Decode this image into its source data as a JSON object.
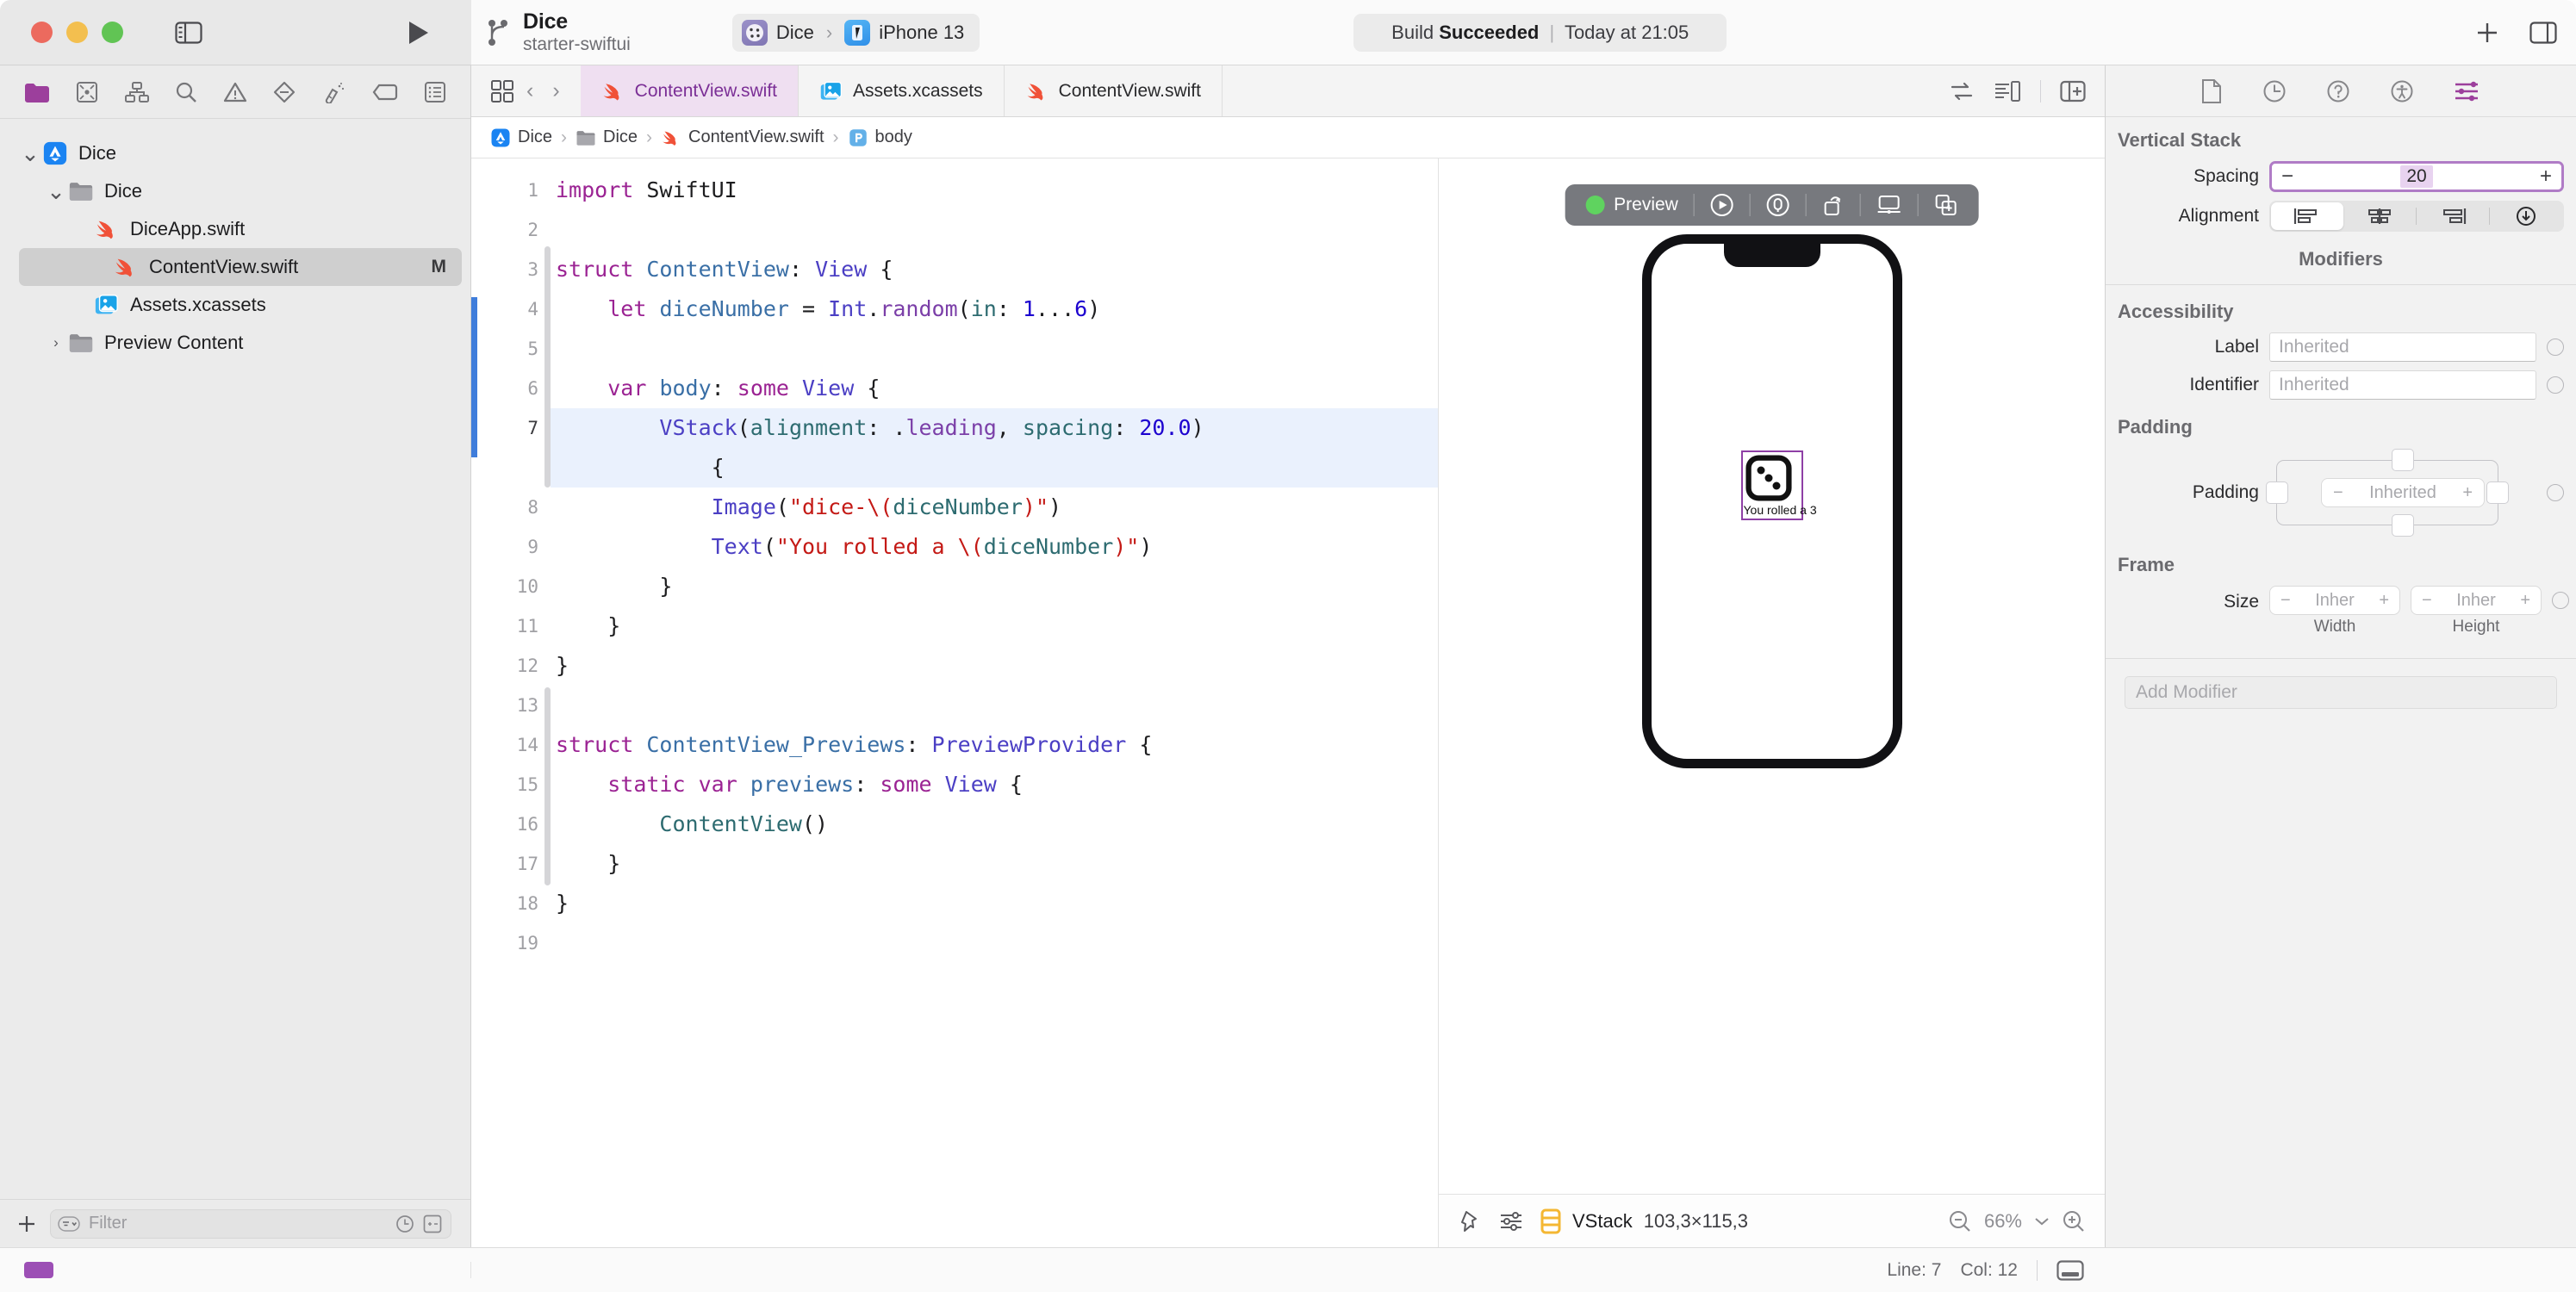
{
  "window": {
    "traffic_lights": [
      "close",
      "minimize",
      "zoom"
    ],
    "colors": {
      "close": "#ec6a5e",
      "minimize": "#f3bf4f",
      "zoom": "#61c454",
      "accent_purple": "#9c4fb5",
      "selection_blue": "#eaf1fd",
      "edit_marker_blue": "#3f7ddb"
    }
  },
  "toolbar": {
    "project_title": "Dice",
    "branch_name": "starter-swiftui",
    "scheme": {
      "target": "Dice",
      "separator": "›",
      "destination": "iPhone 13"
    },
    "status": {
      "prefix": "Build",
      "result": "Succeeded",
      "separator": "|",
      "time": "Today at 21:05"
    },
    "run_button": "run-icon",
    "sidebar_toggle": "sidebar-toggle-icon",
    "inspector_toggle": "inspector-toggle-icon",
    "add_button": "+"
  },
  "navigator": {
    "tabs": [
      {
        "name": "project-navigator",
        "icon": "folder-icon",
        "active": true
      },
      {
        "name": "source-control-navigator",
        "icon": "source-control-icon",
        "active": false
      },
      {
        "name": "symbol-navigator",
        "icon": "hierarchy-icon",
        "active": false
      },
      {
        "name": "find-navigator",
        "icon": "search-icon",
        "active": false
      },
      {
        "name": "issue-navigator",
        "icon": "warning-icon",
        "active": false
      },
      {
        "name": "test-navigator",
        "icon": "diamond-icon",
        "active": false
      },
      {
        "name": "debug-navigator",
        "icon": "spray-icon",
        "active": false
      },
      {
        "name": "breakpoint-navigator",
        "icon": "tag-icon",
        "active": false
      },
      {
        "name": "report-navigator",
        "icon": "report-icon",
        "active": false
      }
    ],
    "tree": [
      {
        "label": "Dice",
        "icon": "xcode-project-icon",
        "indent": 0,
        "twisty": "down",
        "selected": false,
        "badge": ""
      },
      {
        "label": "Dice",
        "icon": "folder-icon",
        "indent": 1,
        "twisty": "down",
        "selected": false,
        "badge": ""
      },
      {
        "label": "DiceApp.swift",
        "icon": "swift-icon",
        "indent": 2,
        "twisty": "",
        "selected": false,
        "badge": ""
      },
      {
        "label": "ContentView.swift",
        "icon": "swift-icon",
        "indent": 2,
        "twisty": "",
        "selected": true,
        "badge": "M"
      },
      {
        "label": "Assets.xcassets",
        "icon": "assets-icon",
        "indent": 2,
        "twisty": "",
        "selected": false,
        "badge": ""
      },
      {
        "label": "Preview Content",
        "icon": "folder-icon",
        "indent": 1,
        "twisty": "right",
        "selected": false,
        "badge": ""
      }
    ],
    "filter": {
      "placeholder": "Filter",
      "add_label": "+",
      "recent_icon": "clock-icon",
      "source-control_icon": "sc-filter-icon"
    }
  },
  "editor": {
    "tabs": [
      {
        "label": "ContentView.swift",
        "icon": "swift-icon",
        "active": true
      },
      {
        "label": "Assets.xcassets",
        "icon": "assets-icon",
        "active": false
      },
      {
        "label": "ContentView.swift",
        "icon": "swift-icon",
        "active": false
      }
    ],
    "nav_back": "‹",
    "nav_forward": "›",
    "tab_grid_icon": "tab-grid-icon",
    "right_icons": [
      "related-items-icon",
      "minimap-icon",
      "add-editor-icon"
    ],
    "breadcrumb": [
      {
        "label": "Dice",
        "icon": "xcode-project-icon"
      },
      {
        "label": "Dice",
        "icon": "folder-icon"
      },
      {
        "label": "ContentView.swift",
        "icon": "swift-icon"
      },
      {
        "label": "body",
        "icon": "property-icon"
      }
    ],
    "line_numbers": [
      "1",
      "2",
      "3",
      "4",
      "5",
      "6",
      "7",
      "8",
      "9",
      "10",
      "11",
      "12",
      "13",
      "14",
      "15",
      "16",
      "17",
      "18",
      "19"
    ]
  },
  "canvas": {
    "preview_toolbar": {
      "status_label": "Preview",
      "status_color": "#5fd35f",
      "icons": [
        "live-preview-icon",
        "inspect-preview-icon",
        "run-device-icon",
        "display-icon",
        "duplicate-preview-icon"
      ]
    },
    "device": "iPhone 13",
    "preview_text": "You rolled a 3",
    "dice_value": 3,
    "selection_color": "#8e3fa5",
    "bottom_bar": {
      "pin_icon": "pin-icon",
      "variants_icon": "variants-icon",
      "selected_view_icon": "vstack-icon",
      "selected_view": "VStack",
      "dimensions": "103,3×115,3",
      "zoom_out_icon": "zoom-out-icon",
      "zoom_level": "66%",
      "zoom_menu_icon": "chevron-down-icon",
      "zoom_in_icon": "zoom-in-icon"
    }
  },
  "inspector": {
    "tabs": [
      {
        "name": "file-inspector",
        "icon": "file-icon",
        "active": false
      },
      {
        "name": "history-inspector",
        "icon": "clock-icon",
        "active": false
      },
      {
        "name": "quick-help-inspector",
        "icon": "question-icon",
        "active": false
      },
      {
        "name": "accessibility-inspector",
        "icon": "accessibility-icon",
        "active": false
      },
      {
        "name": "attributes-inspector",
        "icon": "sliders-icon",
        "active": true
      }
    ],
    "section_title": "Vertical Stack",
    "spacing": {
      "label": "Spacing",
      "value": "20",
      "minus": "−",
      "plus": "+",
      "focused": true
    },
    "alignment": {
      "label": "Alignment",
      "options": [
        "align-leading-icon",
        "align-center-icon",
        "align-trailing-icon",
        "align-baseline-icon"
      ],
      "selected_index": 0
    },
    "modifiers_header": "Modifiers",
    "accessibility": {
      "title": "Accessibility",
      "fields": [
        {
          "label": "Label",
          "placeholder": "Inherited",
          "value": ""
        },
        {
          "label": "Identifier",
          "placeholder": "Inherited",
          "value": ""
        }
      ]
    },
    "padding": {
      "title": "Padding",
      "label": "Padding",
      "placeholder": "Inherited",
      "minus": "−",
      "plus": "+",
      "edges": [
        "top",
        "leading",
        "trailing",
        "bottom"
      ]
    },
    "frame": {
      "title": "Frame",
      "label": "Size",
      "width": {
        "placeholder": "Inher",
        "sublabel": "Width",
        "minus": "−",
        "plus": "+"
      },
      "height": {
        "placeholder": "Inher",
        "sublabel": "Height",
        "minus": "−",
        "plus": "+"
      }
    },
    "add_modifier_placeholder": "Add Modifier"
  },
  "status_bar": {
    "line_label": "Line: 7",
    "col_label": "Col: 12",
    "debug_area_icon": "debug-area-icon"
  },
  "code": {
    "lines": [
      {
        "n": "1",
        "tokens": [
          {
            "t": "import",
            "c": "kw"
          },
          {
            "t": " ",
            "c": "id"
          },
          {
            "t": "SwiftUI",
            "c": "id"
          }
        ]
      },
      {
        "n": "2",
        "tokens": []
      },
      {
        "n": "3",
        "tokens": [
          {
            "t": "struct",
            "c": "kw"
          },
          {
            "t": " ",
            "c": "id"
          },
          {
            "t": "ContentView",
            "c": "type"
          },
          {
            "t": ": ",
            "c": "id"
          },
          {
            "t": "View",
            "c": "typeb"
          },
          {
            "t": " {",
            "c": "id"
          }
        ]
      },
      {
        "n": "4",
        "tokens": [
          {
            "t": "    ",
            "c": "id"
          },
          {
            "t": "let",
            "c": "kw"
          },
          {
            "t": " ",
            "c": "id"
          },
          {
            "t": "diceNumber",
            "c": "type"
          },
          {
            "t": " = ",
            "c": "id"
          },
          {
            "t": "Int",
            "c": "typeb"
          },
          {
            "t": ".",
            "c": "id"
          },
          {
            "t": "random",
            "c": "prop"
          },
          {
            "t": "(",
            "c": "id"
          },
          {
            "t": "in",
            "c": "fn"
          },
          {
            "t": ": ",
            "c": "id"
          },
          {
            "t": "1",
            "c": "num"
          },
          {
            "t": "...",
            "c": "id"
          },
          {
            "t": "6",
            "c": "num"
          },
          {
            "t": ")",
            "c": "id"
          }
        ]
      },
      {
        "n": "5",
        "tokens": []
      },
      {
        "n": "6",
        "tokens": [
          {
            "t": "    ",
            "c": "id"
          },
          {
            "t": "var",
            "c": "kw"
          },
          {
            "t": " ",
            "c": "id"
          },
          {
            "t": "body",
            "c": "type"
          },
          {
            "t": ": ",
            "c": "id"
          },
          {
            "t": "some",
            "c": "kw"
          },
          {
            "t": " ",
            "c": "id"
          },
          {
            "t": "View",
            "c": "typeb"
          },
          {
            "t": " {",
            "c": "id"
          }
        ]
      },
      {
        "n": "7",
        "tokens": [
          {
            "t": "        ",
            "c": "id"
          },
          {
            "t": "VStack",
            "c": "typeb"
          },
          {
            "t": "(",
            "c": "id"
          },
          {
            "t": "alignment",
            "c": "fn"
          },
          {
            "t": ": ",
            "c": "id"
          },
          {
            "t": ".",
            "c": "id"
          },
          {
            "t": "leading",
            "c": "prop"
          },
          {
            "t": ", ",
            "c": "id"
          },
          {
            "t": "spacing",
            "c": "fn"
          },
          {
            "t": ": ",
            "c": "id"
          },
          {
            "t": "20.0",
            "c": "num"
          },
          {
            "t": ")",
            "c": "id"
          }
        ],
        "highlight": true
      },
      {
        "n": "",
        "tokens": [
          {
            "t": "            {",
            "c": "id"
          }
        ],
        "highlight": true,
        "wrap": true
      },
      {
        "n": "8",
        "tokens": [
          {
            "t": "            ",
            "c": "id"
          },
          {
            "t": "Image",
            "c": "typeb"
          },
          {
            "t": "(",
            "c": "id"
          },
          {
            "t": "\"dice-\\(",
            "c": "str"
          },
          {
            "t": "diceNumber",
            "c": "teal"
          },
          {
            "t": ")\"",
            "c": "str"
          },
          {
            "t": ")",
            "c": "id"
          }
        ]
      },
      {
        "n": "9",
        "tokens": [
          {
            "t": "            ",
            "c": "id"
          },
          {
            "t": "Text",
            "c": "typeb"
          },
          {
            "t": "(",
            "c": "id"
          },
          {
            "t": "\"You rolled a \\(",
            "c": "str"
          },
          {
            "t": "diceNumber",
            "c": "teal"
          },
          {
            "t": ")\"",
            "c": "str"
          },
          {
            "t": ")",
            "c": "id"
          }
        ]
      },
      {
        "n": "10",
        "tokens": [
          {
            "t": "        }",
            "c": "id"
          }
        ]
      },
      {
        "n": "11",
        "tokens": [
          {
            "t": "    }",
            "c": "id"
          }
        ]
      },
      {
        "n": "12",
        "tokens": [
          {
            "t": "}",
            "c": "id"
          }
        ]
      },
      {
        "n": "13",
        "tokens": []
      },
      {
        "n": "14",
        "tokens": [
          {
            "t": "struct",
            "c": "kw"
          },
          {
            "t": " ",
            "c": "id"
          },
          {
            "t": "ContentView_Previews",
            "c": "type"
          },
          {
            "t": ": ",
            "c": "id"
          },
          {
            "t": "PreviewProvider",
            "c": "typeb"
          },
          {
            "t": " {",
            "c": "id"
          }
        ]
      },
      {
        "n": "15",
        "tokens": [
          {
            "t": "    ",
            "c": "id"
          },
          {
            "t": "static",
            "c": "kw"
          },
          {
            "t": " ",
            "c": "id"
          },
          {
            "t": "var",
            "c": "kw"
          },
          {
            "t": " ",
            "c": "id"
          },
          {
            "t": "previews",
            "c": "type"
          },
          {
            "t": ": ",
            "c": "id"
          },
          {
            "t": "some",
            "c": "kw"
          },
          {
            "t": " ",
            "c": "id"
          },
          {
            "t": "View",
            "c": "typeb"
          },
          {
            "t": " {",
            "c": "id"
          }
        ]
      },
      {
        "n": "16",
        "tokens": [
          {
            "t": "        ",
            "c": "id"
          },
          {
            "t": "ContentView",
            "c": "fn"
          },
          {
            "t": "()",
            "c": "id"
          }
        ]
      },
      {
        "n": "17",
        "tokens": [
          {
            "t": "    }",
            "c": "id"
          }
        ]
      },
      {
        "n": "18",
        "tokens": [
          {
            "t": "}",
            "c": "id"
          }
        ]
      },
      {
        "n": "19",
        "tokens": []
      }
    ]
  }
}
